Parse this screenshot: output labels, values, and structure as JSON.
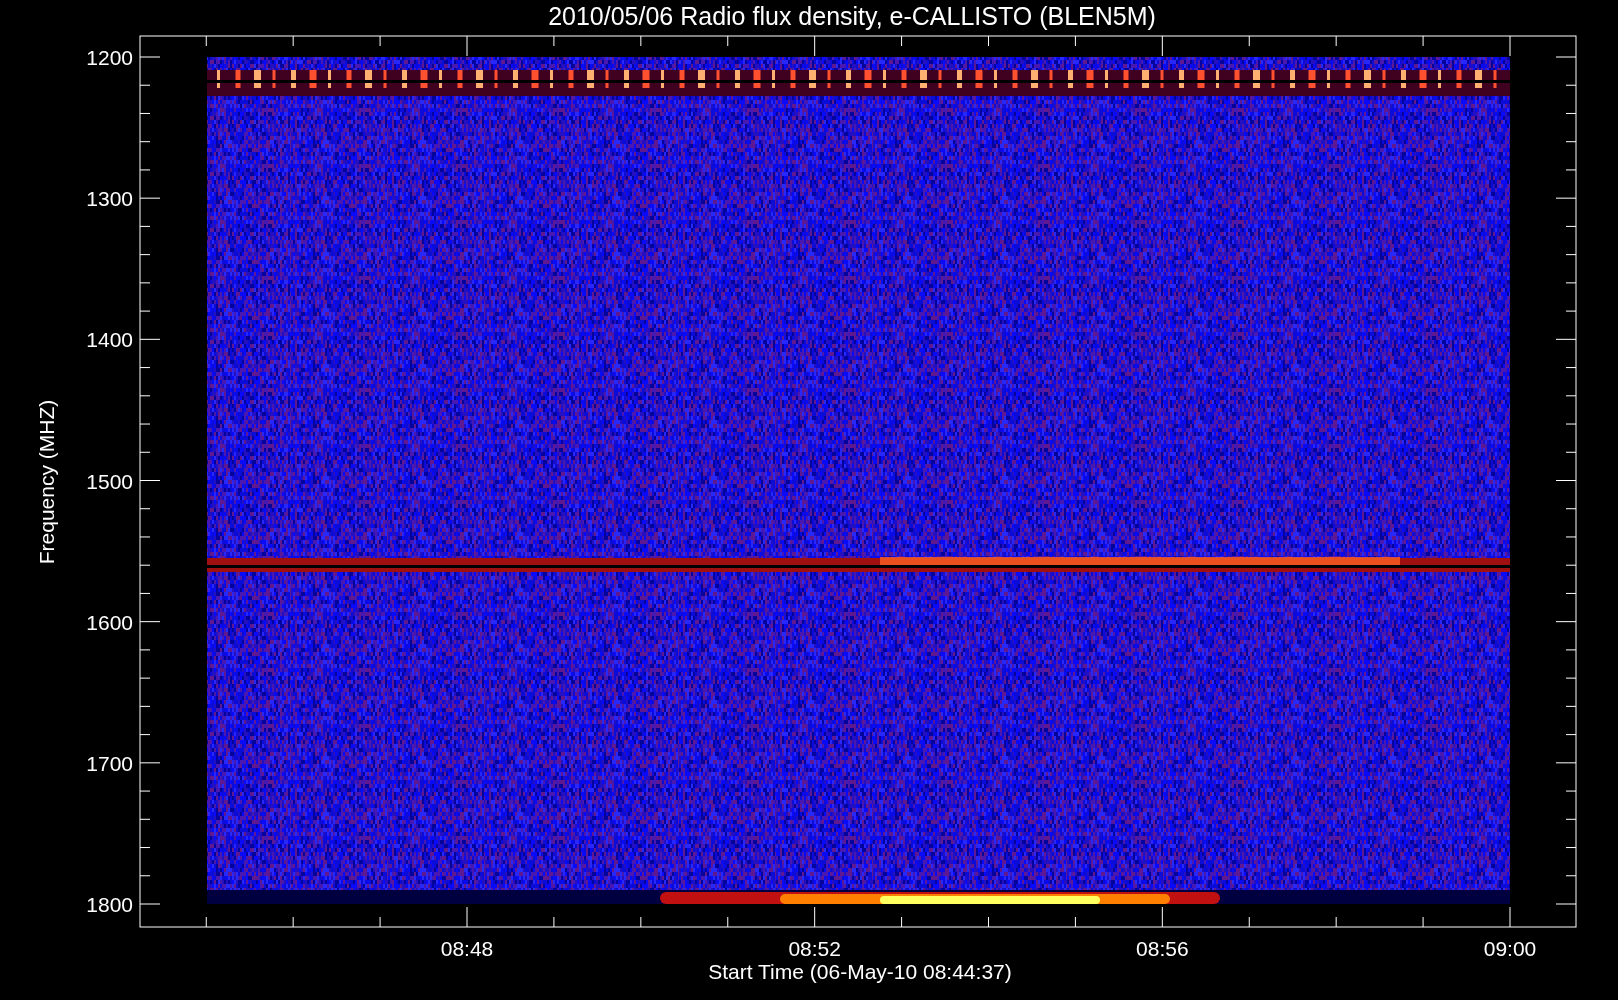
{
  "plot": {
    "title": "2010/05/06  Radio flux density, e-CALLISTO (BLEN5M)",
    "ylabel": "Frequency (MHZ)",
    "xlabel": "Start Time (06-May-10 08:44:37)",
    "yticks": [
      "1200",
      "1300",
      "1400",
      "1500",
      "1600",
      "1700",
      "1800"
    ],
    "xticks": [
      "08:48",
      "08:52",
      "08:56",
      "09:00"
    ]
  }
}
